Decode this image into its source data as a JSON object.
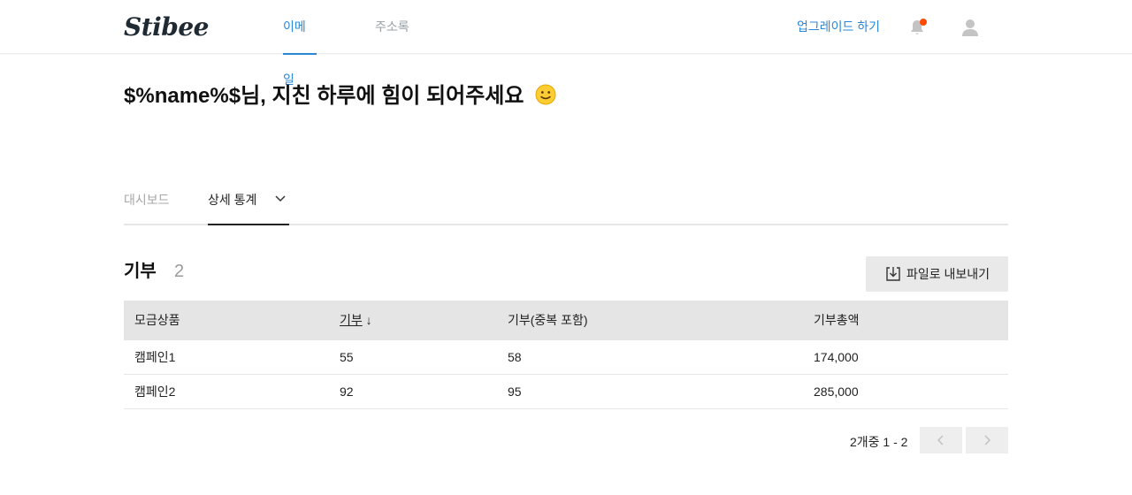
{
  "header": {
    "logo": "Stibee",
    "tabs": [
      {
        "label": "이메일",
        "active": true
      },
      {
        "label": "주소록",
        "active": false
      }
    ],
    "upgrade_label": "업그레이드 하기",
    "notification_badge_color": "#ff4b00",
    "accent_color": "#2b87d6"
  },
  "greeting": {
    "text": "$%name%$님, 지친 하루에 힘이 되어주세요",
    "emoji_icon": "slightly-smiling-face-icon"
  },
  "subtabs": [
    {
      "label": "대시보드",
      "active": false
    },
    {
      "label": "상세 통계",
      "active": true
    }
  ],
  "section": {
    "title": "기부",
    "count": "2",
    "export_label": "파일로 내보내기",
    "export_icon": "download-icon"
  },
  "table": {
    "headers": [
      "모금상품",
      "기부",
      "기부(중복 포함)",
      "기부총액"
    ],
    "sort_indicator": "↓",
    "rows": [
      [
        "캠페인1",
        "55",
        "58",
        "174,000"
      ],
      [
        "캠페인2",
        "92",
        "95",
        "285,000"
      ]
    ]
  },
  "pagination": {
    "summary": "2개중 1 - 2"
  }
}
